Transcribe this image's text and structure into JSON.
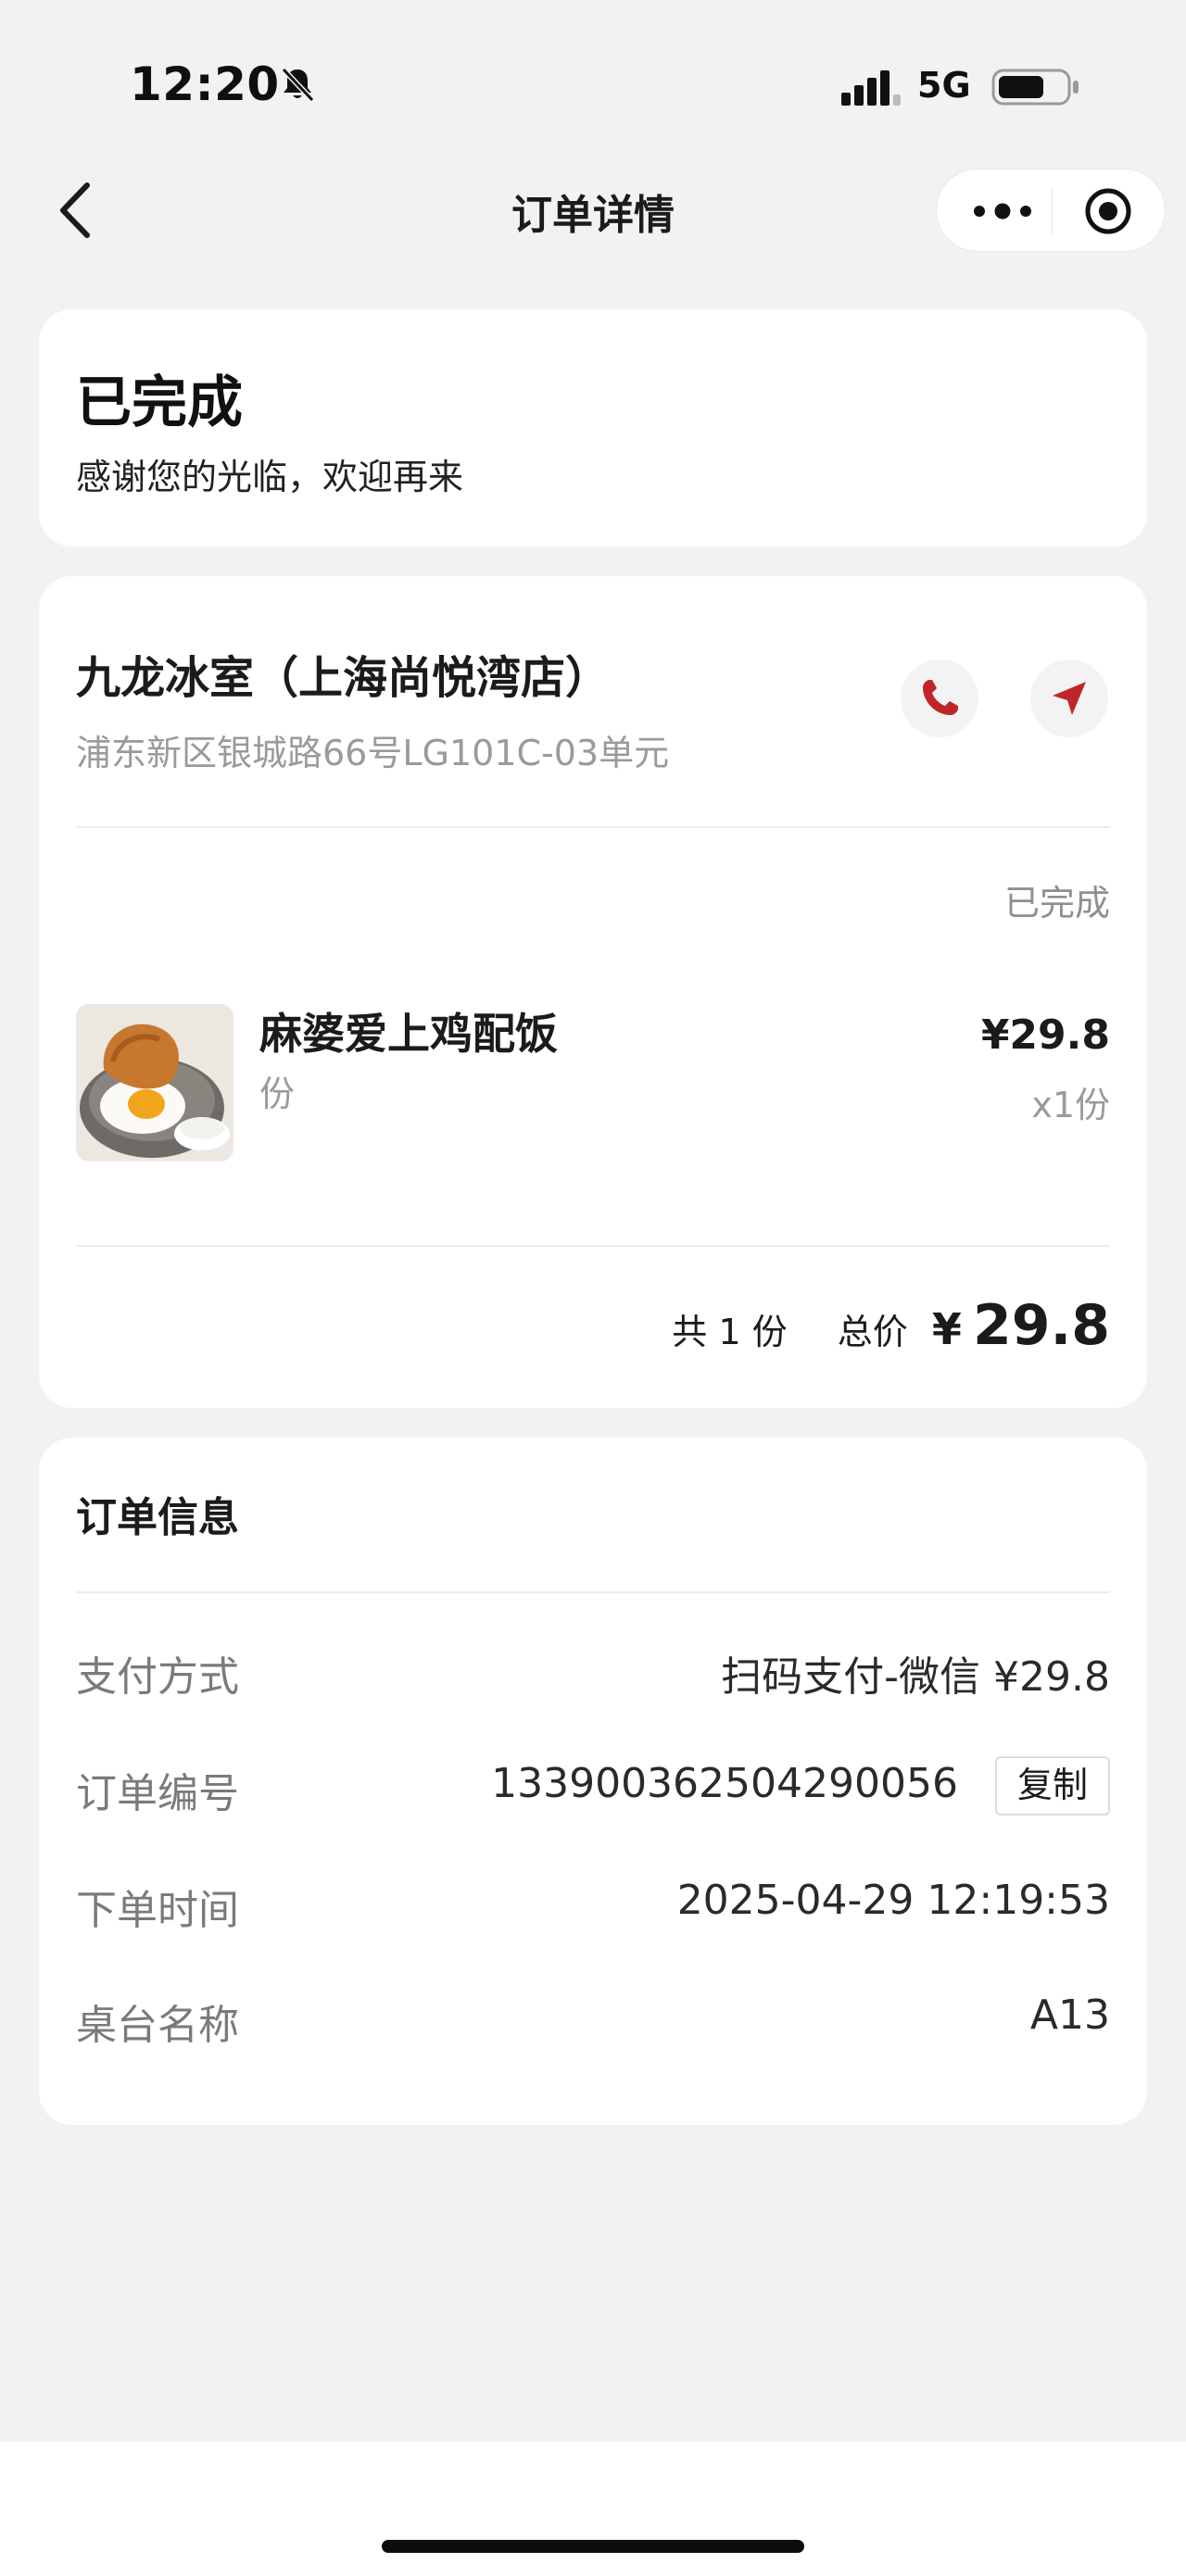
{
  "status_bar": {
    "time": "12:20",
    "network": "5G"
  },
  "nav": {
    "title": "订单详情"
  },
  "status_card": {
    "title": "已完成",
    "subtitle": "感谢您的光临，欢迎再来"
  },
  "store": {
    "name": "九龙冰室（上海尚悦湾店）",
    "address": "浦东新区银城路66号LG101C-03单元",
    "order_state": "已完成"
  },
  "item": {
    "name": "麻婆爱上鸡配饭",
    "unit": "份",
    "price": "¥29.8",
    "qty": "x1份"
  },
  "summary": {
    "count_text": "共 1 份",
    "total_label": "总价",
    "currency": "¥",
    "total_value": "29.8"
  },
  "order_info": {
    "heading": "订单信息",
    "rows": [
      {
        "label": "支付方式",
        "value": "扫码支付-微信 ¥29.8"
      },
      {
        "label": "订单编号",
        "value": "133900362504290056",
        "action": "复制"
      },
      {
        "label": "下单时间",
        "value": "2025-04-29 12:19:53"
      },
      {
        "label": "桌台名称",
        "value": "A13"
      }
    ]
  },
  "colors": {
    "accent": "#c0252a",
    "background": "#f2f2f3",
    "card": "#ffffff",
    "muted_text": "#9a9a9a"
  },
  "icons": [
    "bell-slash-icon",
    "signal-icon",
    "battery-icon",
    "back-icon",
    "more-icon",
    "target-icon",
    "phone-icon",
    "navigation-arrow-icon"
  ]
}
